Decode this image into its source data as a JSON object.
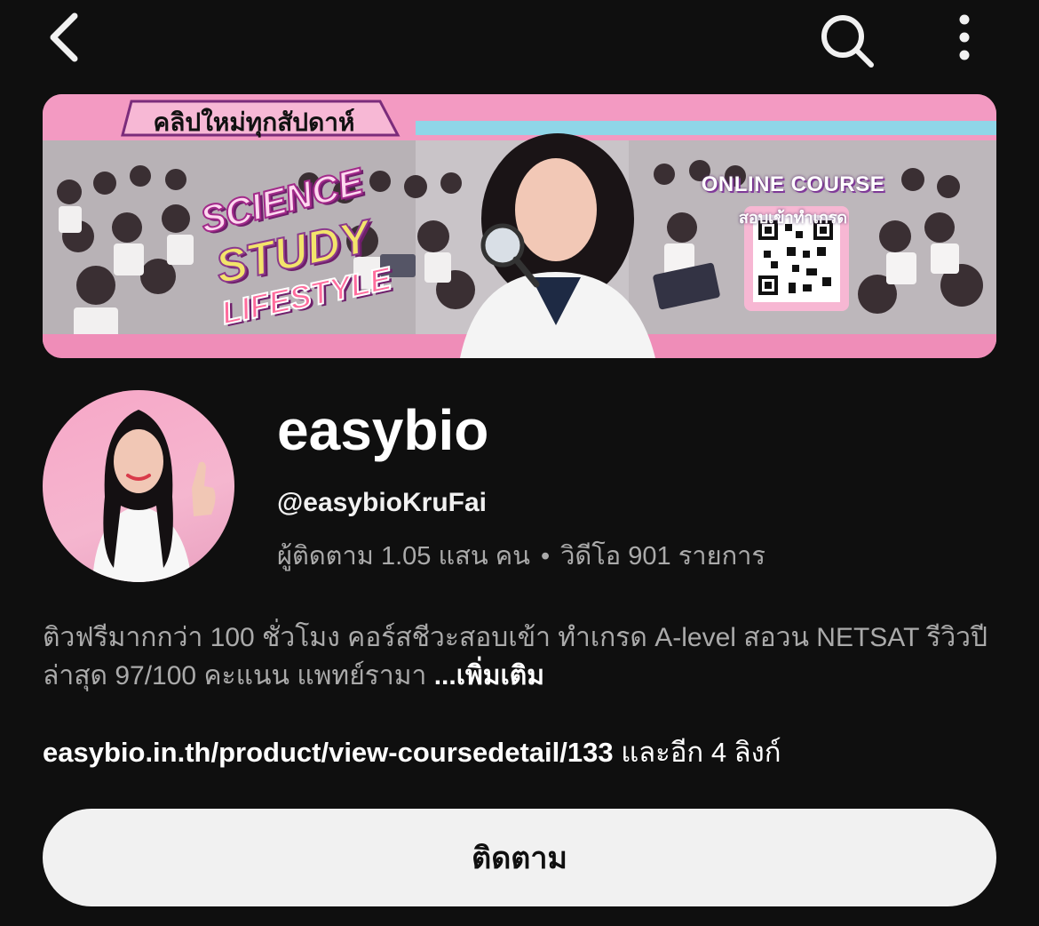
{
  "topbar": {
    "back_icon": "chevron-left-icon",
    "search_icon": "search-icon",
    "more_icon": "vertical-dots-icon"
  },
  "banner": {
    "top_text": "คลิปใหม่ทุกสัปดาห์",
    "wordart": [
      "SCIENCE",
      "STUDY",
      "LIFESTYLE"
    ],
    "course_title": "ONLINE COURSE",
    "course_sub": "สอบเข้าทำเกรด"
  },
  "channel": {
    "name": "easybio",
    "handle": "@easybioKruFai",
    "subscribers": "ผู้ติดตาม 1.05 แสน คน",
    "videos": "วิดีโอ 901 รายการ",
    "separator": "•"
  },
  "description": {
    "text": "ติวฟรีมากกว่า 100 ชั่วโมง คอร์สชีวะสอบเข้า ทำเกรด A-level สอวน NETSAT  รีวิวปีล่าสุด 97/100 คะแนน แพทย์รามา ",
    "more_label": "...เพิ่มเติม"
  },
  "links": {
    "url": "easybio.in.th/product/view-coursedetail/133",
    "extra": " และอีก 4 ลิงก์"
  },
  "subscribe_button": {
    "label": "ติดตาม"
  },
  "colors": {
    "background": "#0f0f0f",
    "primary_text": "#f1f1f1",
    "secondary_text": "#aaaaaa",
    "button_bg": "#f1f1f1",
    "banner_pink": "#f4a9cb"
  }
}
